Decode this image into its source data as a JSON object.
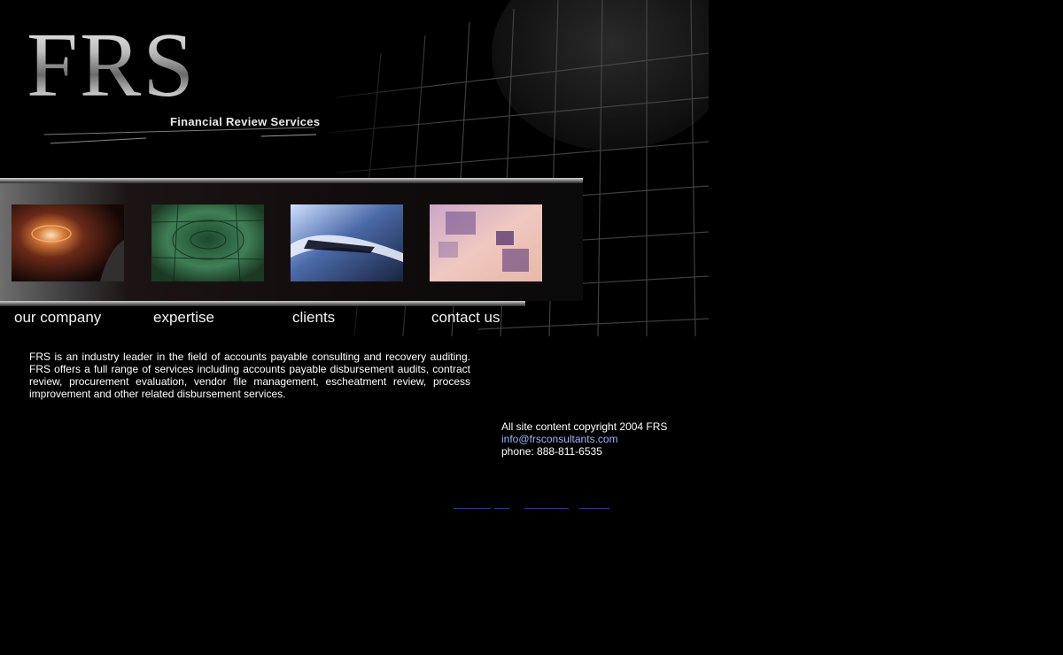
{
  "header": {
    "logo_text": "FRS",
    "tagline": "Financial Review Services"
  },
  "nav": {
    "items": [
      {
        "label": "our company",
        "image_icon": "light-tunnel-image"
      },
      {
        "label": "expertise",
        "image_icon": "green-globe-grid-image"
      },
      {
        "label": "clients",
        "image_icon": "blue-motion-streak-image"
      },
      {
        "label": "contact us",
        "image_icon": "purple-squares-image"
      }
    ]
  },
  "main": {
    "intro": "FRS is an industry leader in the field of accounts payable consulting and recovery auditing. FRS offers a full range of services including accounts payable disbursement audits, contract review, procurement evaluation, vendor file management, escheatment review, process improvement and other related disbursement services."
  },
  "footer": {
    "copyright": "All site content copyright 2004 FRS",
    "email": "info@frsconsultants.com",
    "phone": "phone: 888-811-6535"
  },
  "colors": {
    "background": "#000000",
    "text": "#ffffff",
    "link": "#9fb3ff",
    "hidden_link_underline": "#1a2fd0"
  }
}
